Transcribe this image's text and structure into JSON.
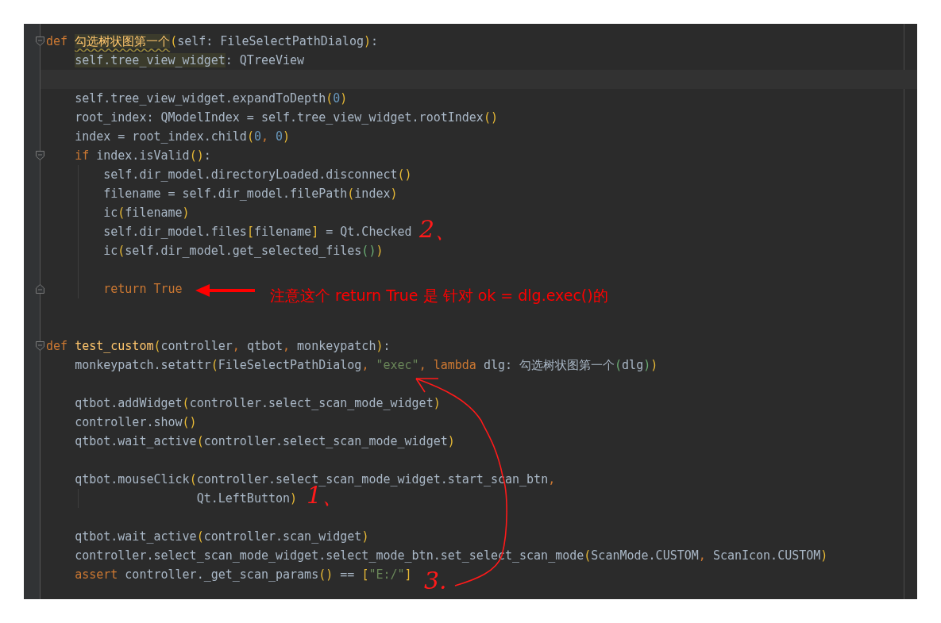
{
  "editor": {
    "lines": [
      {
        "kind": "code",
        "fold_start": true,
        "tokens": [
          {
            "kind": "k",
            "text": "def "
          },
          {
            "kind": "w",
            "text": "勾选树状图第一个"
          },
          {
            "kind": "b1",
            "text": "("
          },
          {
            "kind": "p",
            "text": "self: FileSelectPathDialog"
          },
          {
            "kind": "b1",
            "text": ")"
          },
          {
            "kind": "p",
            "text": ":"
          }
        ]
      },
      {
        "kind": "code",
        "tokens": [
          {
            "kind": "h",
            "text": "    self.tree_view_widget"
          },
          {
            "kind": "p",
            "text": ": QTreeView"
          }
        ]
      },
      {
        "kind": "blank",
        "current": true
      },
      {
        "kind": "code",
        "tokens": [
          {
            "kind": "p",
            "text": "    self.tree_view_widget.expandToDepth"
          },
          {
            "kind": "b1",
            "text": "("
          },
          {
            "kind": "n",
            "text": "0"
          },
          {
            "kind": "b1",
            "text": ")"
          }
        ]
      },
      {
        "kind": "code",
        "tokens": [
          {
            "kind": "p",
            "text": "    root_index: QModelIndex = self.tree_view_widget.rootIndex"
          },
          {
            "kind": "b1",
            "text": "()"
          }
        ]
      },
      {
        "kind": "code",
        "tokens": [
          {
            "kind": "p",
            "text": "    index = root_index.child"
          },
          {
            "kind": "b1",
            "text": "("
          },
          {
            "kind": "n",
            "text": "0"
          },
          {
            "kind": "c",
            "text": ", "
          },
          {
            "kind": "n",
            "text": "0"
          },
          {
            "kind": "b1",
            "text": ")"
          }
        ]
      },
      {
        "kind": "code",
        "fold_start": true,
        "tokens": [
          {
            "kind": "k",
            "text": "    if"
          },
          {
            "kind": "p",
            "text": " index.isValid"
          },
          {
            "kind": "b1",
            "text": "()"
          },
          {
            "kind": "p",
            "text": ":"
          }
        ]
      },
      {
        "kind": "code",
        "guide": true,
        "tokens": [
          {
            "kind": "p",
            "text": "        self.dir_model.directoryLoaded.disconnect"
          },
          {
            "kind": "b1",
            "text": "()"
          }
        ]
      },
      {
        "kind": "code",
        "guide": true,
        "tokens": [
          {
            "kind": "p",
            "text": "        filename = self.dir_model.filePath"
          },
          {
            "kind": "b1",
            "text": "("
          },
          {
            "kind": "p",
            "text": "index"
          },
          {
            "kind": "b1",
            "text": ")"
          }
        ]
      },
      {
        "kind": "code",
        "guide": true,
        "tokens": [
          {
            "kind": "p",
            "text": "        ic"
          },
          {
            "kind": "b1",
            "text": "("
          },
          {
            "kind": "p",
            "text": "filename"
          },
          {
            "kind": "b1",
            "text": ")"
          }
        ]
      },
      {
        "kind": "code",
        "guide": true,
        "tokens": [
          {
            "kind": "p",
            "text": "        self.dir_model.files"
          },
          {
            "kind": "b1",
            "text": "["
          },
          {
            "kind": "p",
            "text": "filename"
          },
          {
            "kind": "b1",
            "text": "]"
          },
          {
            "kind": "p",
            "text": " = Qt.Checked"
          }
        ]
      },
      {
        "kind": "code",
        "guide": true,
        "tokens": [
          {
            "kind": "p",
            "text": "        ic"
          },
          {
            "kind": "b1",
            "text": "("
          },
          {
            "kind": "p",
            "text": "self.dir_model.get_selected_files"
          },
          {
            "kind": "b2",
            "text": "()"
          },
          {
            "kind": "b1",
            "text": ")"
          }
        ]
      },
      {
        "kind": "blank",
        "guide": true
      },
      {
        "kind": "code",
        "guide": true,
        "fold_end": true,
        "tokens": [
          {
            "kind": "k",
            "text": "        return True"
          }
        ]
      },
      {
        "kind": "blank"
      },
      {
        "kind": "blank"
      },
      {
        "kind": "code",
        "fold_start": true,
        "tokens": [
          {
            "kind": "k",
            "text": "def "
          },
          {
            "kind": "f",
            "text": "test_custom"
          },
          {
            "kind": "b1",
            "text": "("
          },
          {
            "kind": "p",
            "text": "controller"
          },
          {
            "kind": "c",
            "text": ", "
          },
          {
            "kind": "p",
            "text": "qtbot"
          },
          {
            "kind": "c",
            "text": ", "
          },
          {
            "kind": "p",
            "text": "monkeypatch"
          },
          {
            "kind": "b1",
            "text": ")"
          },
          {
            "kind": "p",
            "text": ":"
          }
        ]
      },
      {
        "kind": "code",
        "tokens": [
          {
            "kind": "p",
            "text": "    monkeypatch.setattr"
          },
          {
            "kind": "b1",
            "text": "("
          },
          {
            "kind": "p",
            "text": "FileSelectPathDialog"
          },
          {
            "kind": "c",
            "text": ", "
          },
          {
            "kind": "s",
            "text": "\"exec\""
          },
          {
            "kind": "c",
            "text": ", "
          },
          {
            "kind": "k",
            "text": "lambda"
          },
          {
            "kind": "p",
            "text": " dlg: 勾选树状图第一个"
          },
          {
            "kind": "b2",
            "text": "("
          },
          {
            "kind": "p",
            "text": "dlg"
          },
          {
            "kind": "b2",
            "text": ")"
          },
          {
            "kind": "b1",
            "text": ")"
          }
        ]
      },
      {
        "kind": "blank"
      },
      {
        "kind": "code",
        "tokens": [
          {
            "kind": "p",
            "text": "    qtbot.addWidget"
          },
          {
            "kind": "b1",
            "text": "("
          },
          {
            "kind": "p",
            "text": "controller.select_scan_mode_widget"
          },
          {
            "kind": "b1",
            "text": ")"
          }
        ]
      },
      {
        "kind": "code",
        "tokens": [
          {
            "kind": "p",
            "text": "    controller.show"
          },
          {
            "kind": "b1",
            "text": "()"
          }
        ]
      },
      {
        "kind": "code",
        "tokens": [
          {
            "kind": "p",
            "text": "    qtbot.wait_active"
          },
          {
            "kind": "b1",
            "text": "("
          },
          {
            "kind": "p",
            "text": "controller.select_scan_mode_widget"
          },
          {
            "kind": "b1",
            "text": ")"
          }
        ]
      },
      {
        "kind": "blank"
      },
      {
        "kind": "code",
        "tokens": [
          {
            "kind": "p",
            "text": "    qtbot.mouseClick"
          },
          {
            "kind": "b1",
            "text": "("
          },
          {
            "kind": "p",
            "text": "controller.select_scan_mode_widget.start_scan_btn"
          },
          {
            "kind": "c",
            "text": ","
          }
        ]
      },
      {
        "kind": "code",
        "guide": true,
        "tokens": [
          {
            "kind": "p",
            "text": "                     Qt.LeftButton"
          },
          {
            "kind": "b1",
            "text": ")"
          }
        ]
      },
      {
        "kind": "blank"
      },
      {
        "kind": "code",
        "tokens": [
          {
            "kind": "p",
            "text": "    qtbot.wait_active"
          },
          {
            "kind": "b1",
            "text": "("
          },
          {
            "kind": "p",
            "text": "controller.scan_widget"
          },
          {
            "kind": "b1",
            "text": ")"
          }
        ]
      },
      {
        "kind": "code",
        "tokens": [
          {
            "kind": "p",
            "text": "    controller.select_scan_mode_widget.select_mode_btn.set_select_scan_mode"
          },
          {
            "kind": "b1",
            "text": "("
          },
          {
            "kind": "p",
            "text": "ScanMode.CUSTOM"
          },
          {
            "kind": "c",
            "text": ", "
          },
          {
            "kind": "p",
            "text": "ScanIcon.CUSTOM"
          },
          {
            "kind": "b1",
            "text": ")"
          }
        ]
      },
      {
        "kind": "code",
        "tokens": [
          {
            "kind": "k",
            "text": "    assert"
          },
          {
            "kind": "p",
            "text": " controller._get_scan_params"
          },
          {
            "kind": "b1",
            "text": "()"
          },
          {
            "kind": "p",
            "text": " == "
          },
          {
            "kind": "b1",
            "text": "["
          },
          {
            "kind": "s",
            "text": "\"E:/\""
          },
          {
            "kind": "b1",
            "text": "]"
          }
        ]
      }
    ]
  },
  "annotations": [
    {
      "kind": "note",
      "text": "注意这个 return True 是 针对 ok = dlg.exec()的"
    },
    {
      "kind": "step",
      "text": "2、"
    },
    {
      "kind": "step",
      "text": "1、"
    },
    {
      "kind": "step",
      "text": "3."
    }
  ]
}
